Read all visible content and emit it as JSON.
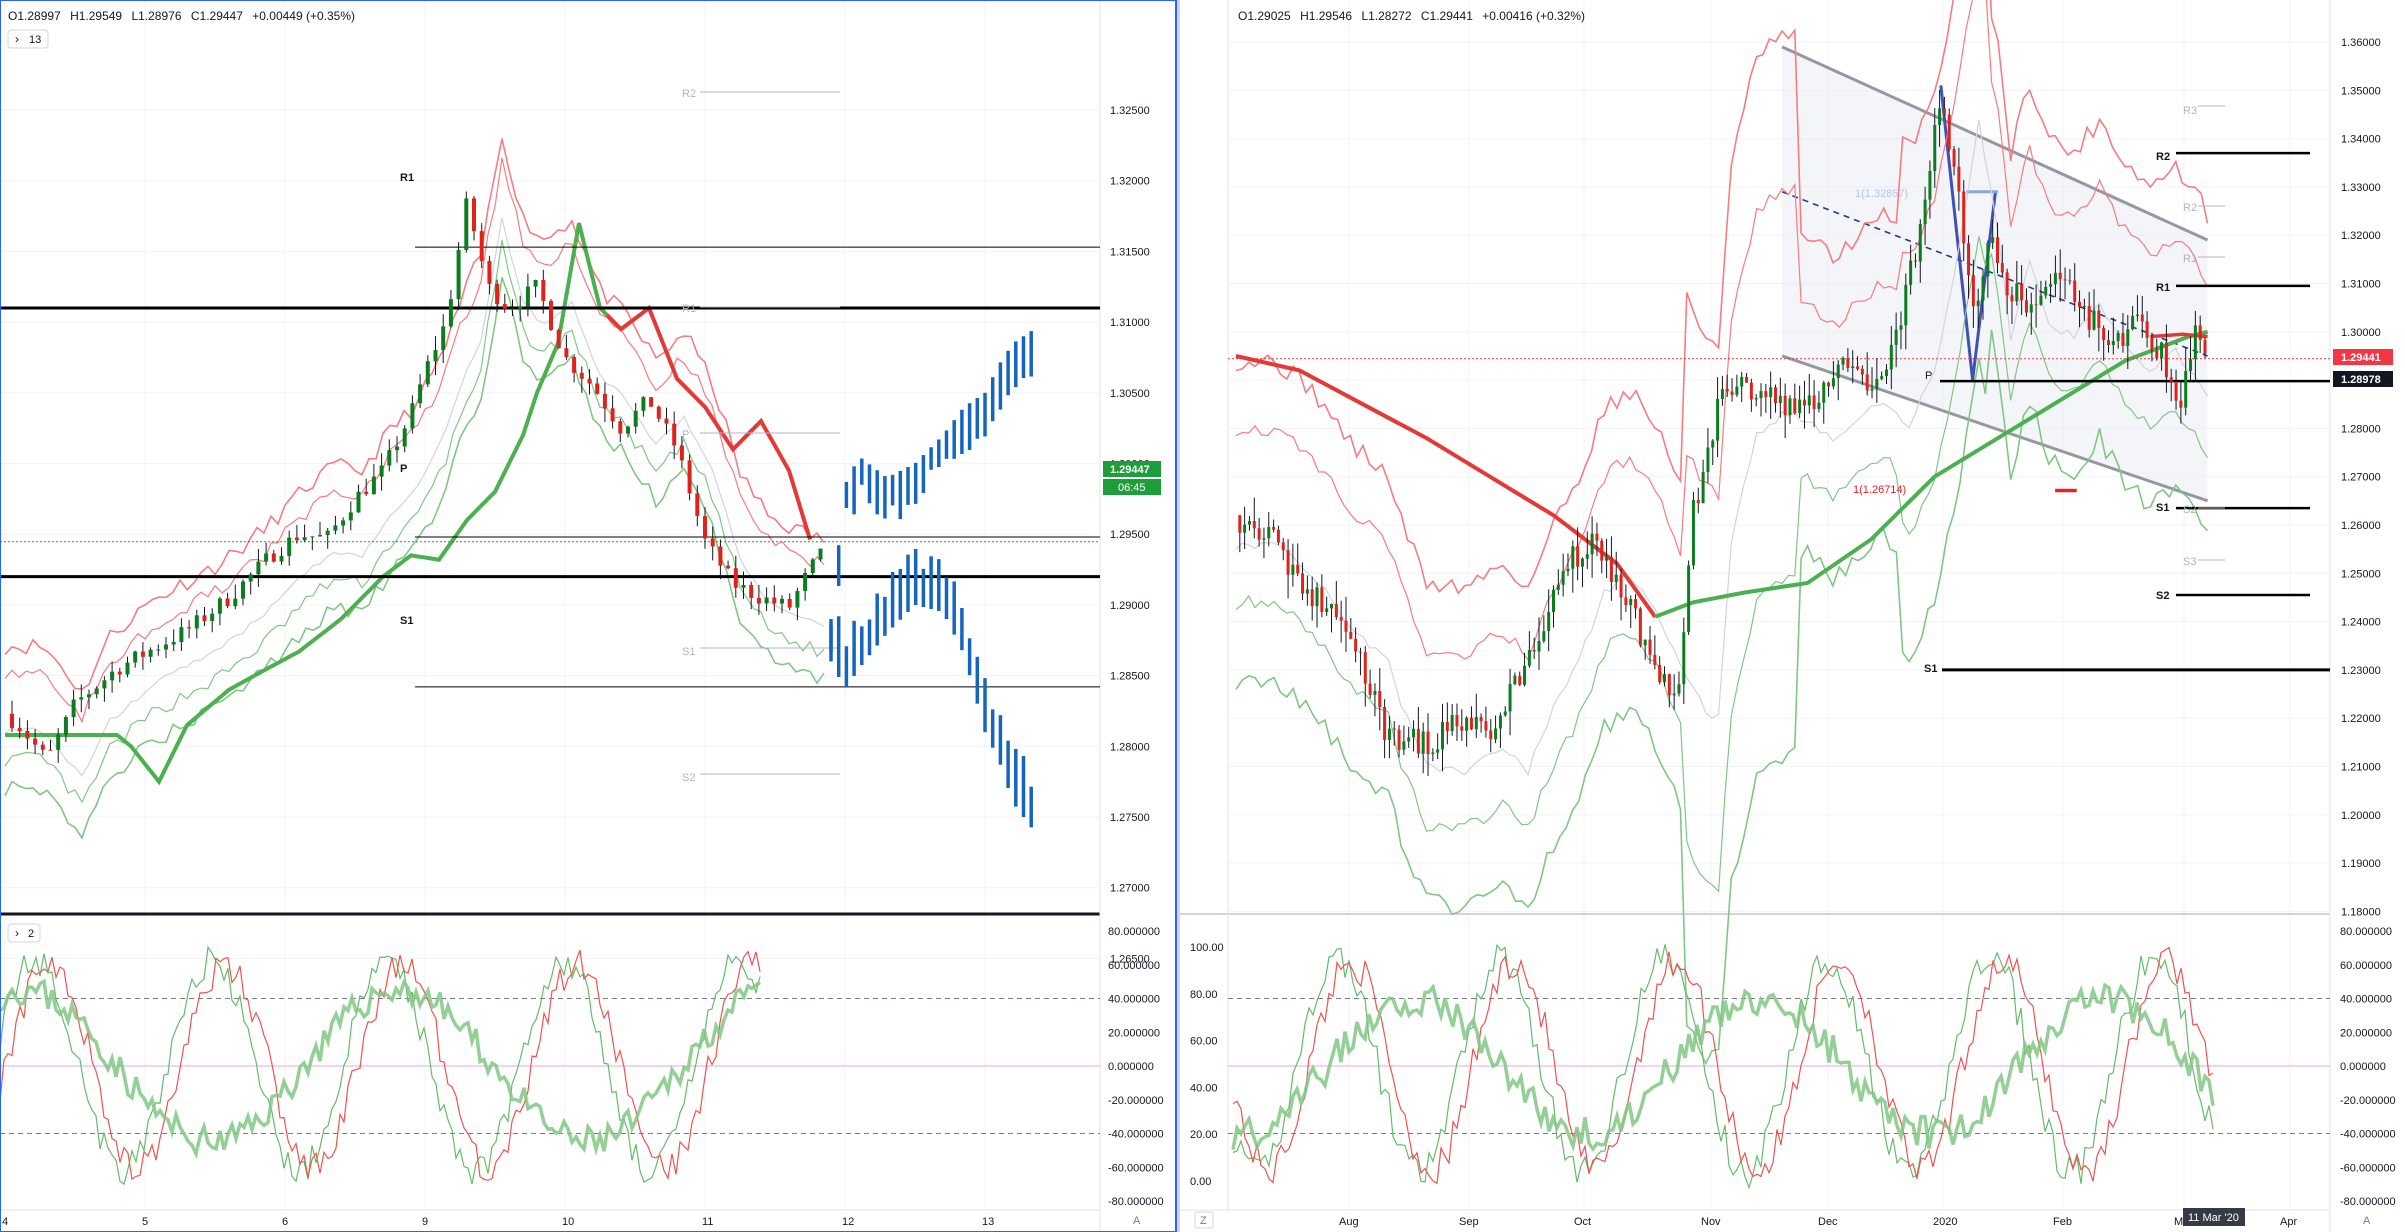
{
  "left": {
    "ohlc": {
      "o": "O1.28997",
      "h": "H1.29549",
      "l": "L1.28976",
      "c": "C1.29447",
      "chg": "+0.00449 (+0.35%)"
    },
    "collapse_btn": "13",
    "indicator_btn": "2",
    "price_ticks": [
      "1.32500",
      "1.32000",
      "1.31500",
      "1.31000",
      "1.30500",
      "1.30000",
      "1.29500",
      "1.29000",
      "1.28500",
      "1.28000",
      "1.27500",
      "1.27000",
      "1.26500"
    ],
    "price_label": "1.29447",
    "countdown": "06:45",
    "x_labels": [
      "4",
      "5",
      "6",
      "9",
      "10",
      "11",
      "12",
      "13"
    ],
    "osc_ticks": [
      "80.000000",
      "60.000000",
      "40.000000",
      "20.000000",
      "0.000000",
      "-20.000000",
      "-40.000000",
      "-60.000000",
      "-80.000000"
    ],
    "pivots": {
      "r1": "R1",
      "p": "P",
      "s1": "S1",
      "r2_ghost": "R2",
      "r1_ghost": "R1",
      "p_ghost": "P",
      "s1_ghost": "S1",
      "s2_ghost": "S2"
    },
    "auto_btn": "A"
  },
  "right": {
    "ohlc": {
      "o": "O1.29025",
      "h": "H1.29546",
      "l": "L1.28272",
      "c": "C1.29441",
      "chg": "+0.00416 (+0.32%)"
    },
    "price_ticks": [
      "1.36000",
      "1.35000",
      "1.34000",
      "1.33000",
      "1.32000",
      "1.31000",
      "1.30000",
      "1.29000",
      "1.28000",
      "1.27000",
      "1.26000",
      "1.25000",
      "1.24000",
      "1.23000",
      "1.22000",
      "1.21000",
      "1.20000",
      "1.19000",
      "1.18000"
    ],
    "price_label_red": "1.29441",
    "price_label_dark": "1.28978",
    "x_labels": [
      "Aug",
      "Sep",
      "Oct",
      "Nov",
      "Dec",
      "2020",
      "Feb",
      "Mar",
      "Apr"
    ],
    "cursor_date": "11 Mar '20",
    "osc_left_ticks": [
      "100.00",
      "80.00",
      "60.00",
      "40.00",
      "20.00",
      "0.00"
    ],
    "osc_ticks": [
      "80.000000",
      "60.000000",
      "40.000000",
      "20.000000",
      "0.000000",
      "-20.000000",
      "-40.000000",
      "-60.000000",
      "-80.000000"
    ],
    "fib_label": "1(1.26714)",
    "fib_ghost": "1(1.32857)",
    "pivots": {
      "r3": "R3",
      "r2": "R2",
      "r2_ghost": "R2",
      "r1_ghost": "R1",
      "r1": "R1",
      "p": "P",
      "s1": "S1",
      "s1_big": "S1",
      "s2": "S2",
      "s2_ghost": "S2",
      "s3": "S3"
    },
    "z_btn": "Z",
    "auto_btn": "A"
  },
  "chart_data": [
    {
      "type": "candlestick",
      "title": "",
      "timeframe_labels": [
        "4",
        "5",
        "6",
        "9",
        "10",
        "11",
        "12",
        "13"
      ],
      "ylim": [
        1.262,
        1.328
      ],
      "last_price": 1.29447,
      "ohlc_header": {
        "open": 1.28997,
        "high": 1.29549,
        "low": 1.28976,
        "close": 1.29447,
        "change": 0.00449,
        "change_pct": 0.35
      },
      "pivot_levels": {
        "R1": 1.3153,
        "P": 1.2948,
        "S1": 1.2842
      },
      "horizontal_lines": [
        1.311,
        1.292
      ],
      "price_path": [
        [
          0,
          1.2823
        ],
        [
          0.1,
          1.2815
        ],
        [
          0.3,
          1.279
        ],
        [
          0.5,
          1.283
        ],
        [
          0.8,
          1.2855
        ],
        [
          1.0,
          1.2866
        ],
        [
          1.3,
          1.2882
        ],
        [
          1.6,
          1.2905
        ],
        [
          1.9,
          1.2935
        ],
        [
          2.1,
          1.295
        ],
        [
          2.3,
          1.2947
        ],
        [
          2.5,
          1.2975
        ],
        [
          2.7,
          1.2995
        ],
        [
          2.9,
          1.3035
        ],
        [
          3.0,
          1.3065
        ],
        [
          3.15,
          1.31
        ],
        [
          3.3,
          1.3185
        ],
        [
          3.45,
          1.3125
        ],
        [
          3.6,
          1.311
        ],
        [
          3.8,
          1.3125
        ],
        [
          4.0,
          1.3075
        ],
        [
          4.2,
          1.3055
        ],
        [
          4.4,
          1.3025
        ],
        [
          4.6,
          1.3045
        ],
        [
          4.8,
          1.301
        ],
        [
          5.0,
          1.2945
        ],
        [
          5.2,
          1.2915
        ],
        [
          5.4,
          1.2905
        ],
        [
          5.6,
          1.2898
        ],
        [
          5.75,
          1.2925
        ],
        [
          5.85,
          1.2938
        ]
      ],
      "projection_path": [
        [
          5.9,
          1.289
        ],
        [
          6.0,
          1.2985
        ],
        [
          6.1,
          1.3005
        ],
        [
          6.3,
          1.299
        ],
        [
          6.5,
          1.3
        ],
        [
          6.7,
          1.302
        ],
        [
          6.85,
          1.304
        ],
        [
          7.0,
          1.305
        ],
        [
          7.1,
          1.307
        ],
        [
          7.2,
          1.3085
        ],
        [
          7.35,
          1.3095
        ]
      ],
      "projection_path_lower": [
        [
          5.9,
          1.286
        ],
        [
          6.0,
          1.284
        ],
        [
          6.1,
          1.2855
        ],
        [
          6.3,
          1.288
        ],
        [
          6.5,
          1.29
        ],
        [
          6.7,
          1.2895
        ],
        [
          6.85,
          1.2865
        ],
        [
          7.0,
          1.281
        ],
        [
          7.1,
          1.279
        ],
        [
          7.2,
          1.276
        ],
        [
          7.35,
          1.274
        ]
      ],
      "oscillator": {
        "ylim": [
          -85,
          85
        ],
        "levels": [
          40,
          0,
          -40
        ],
        "fast_last": 51,
        "slow_last": 11
      }
    },
    {
      "type": "candlestick",
      "title": "",
      "timeframe_labels": [
        "Aug",
        "Sep",
        "Oct",
        "Nov",
        "Dec",
        "2020",
        "Feb",
        "Mar",
        "Apr"
      ],
      "ylim": [
        1.178,
        1.365
      ],
      "last_price": 1.29441,
      "ohlc_header": {
        "open": 1.29025,
        "high": 1.29546,
        "low": 1.28272,
        "close": 1.29441,
        "change": 0.00416,
        "change_pct": 0.32
      },
      "pivot_levels": {
        "R3": 1.3465,
        "R2": 1.337,
        "R1": 1.3095,
        "P": 1.29,
        "S1": 1.2635,
        "S2": 1.2455,
        "S3": 1.253,
        "S1_yearly": 1.23
      },
      "price_path": [
        [
          0,
          1.262
        ],
        [
          0.3,
          1.256
        ],
        [
          0.6,
          1.245
        ],
        [
          0.9,
          1.238
        ],
        [
          1.0,
          1.229
        ],
        [
          1.2,
          1.216
        ],
        [
          1.5,
          1.215
        ],
        [
          1.8,
          1.22
        ],
        [
          2.0,
          1.215
        ],
        [
          2.2,
          1.228
        ],
        [
          2.4,
          1.238
        ],
        [
          2.6,
          1.252
        ],
        [
          2.8,
          1.256
        ],
        [
          3.0,
          1.249
        ],
        [
          3.2,
          1.237
        ],
        [
          3.4,
          1.227
        ],
        [
          3.5,
          1.226
        ],
        [
          3.6,
          1.262
        ],
        [
          3.8,
          1.285
        ],
        [
          4.0,
          1.289
        ],
        [
          4.2,
          1.288
        ],
        [
          4.4,
          1.283
        ],
        [
          4.6,
          1.288
        ],
        [
          4.8,
          1.292
        ],
        [
          5.0,
          1.287
        ],
        [
          5.2,
          1.298
        ],
        [
          5.4,
          1.324
        ],
        [
          5.55,
          1.35
        ],
        [
          5.7,
          1.327
        ],
        [
          5.8,
          1.305
        ],
        [
          5.95,
          1.32
        ],
        [
          6.1,
          1.308
        ],
        [
          6.3,
          1.305
        ],
        [
          6.5,
          1.312
        ],
        [
          6.7,
          1.303
        ],
        [
          6.9,
          1.298
        ],
        [
          7.1,
          1.302
        ],
        [
          7.3,
          1.295
        ],
        [
          7.45,
          1.285
        ],
        [
          7.55,
          1.3
        ],
        [
          7.65,
          1.2944
        ]
      ],
      "moving_average_long": [
        [
          0,
          1.297
        ],
        [
          0.5,
          1.295
        ],
        [
          1.0,
          1.288
        ],
        [
          1.5,
          1.279
        ],
        [
          2.0,
          1.269
        ],
        [
          2.5,
          1.26
        ],
        [
          3.0,
          1.252
        ],
        [
          3.3,
          1.241
        ],
        [
          3.6,
          1.244
        ],
        [
          4.0,
          1.246
        ],
        [
          4.5,
          1.248
        ],
        [
          5.0,
          1.257
        ],
        [
          5.5,
          1.27
        ],
        [
          6.0,
          1.278
        ],
        [
          6.5,
          1.286
        ],
        [
          7.0,
          1.294
        ],
        [
          7.5,
          1.299
        ],
        [
          7.65,
          1.3
        ]
      ],
      "moving_average_mid": [
        [
          0,
          1.295
        ],
        [
          0.5,
          1.292
        ],
        [
          1.0,
          1.285
        ],
        [
          1.5,
          1.278
        ],
        [
          2.0,
          1.27
        ],
        [
          2.5,
          1.262
        ],
        [
          3.0,
          1.252
        ],
        [
          3.3,
          1.241
        ]
      ],
      "channel": {
        "upper": [
          [
            4.3,
            1.359
          ],
          [
            7.65,
            1.319
          ]
        ],
        "lower": [
          [
            4.3,
            1.295
          ],
          [
            7.65,
            1.265
          ]
        ],
        "mid_dashed": [
          [
            4.3,
            1.329
          ],
          [
            7.65,
            1.295
          ]
        ]
      },
      "fib_level": 1.26714,
      "oscillator": {
        "ylim": [
          -5,
          105
        ],
        "levels": [
          80,
          50,
          20
        ],
        "fast_last": 63,
        "slow_last": 48
      }
    }
  ]
}
